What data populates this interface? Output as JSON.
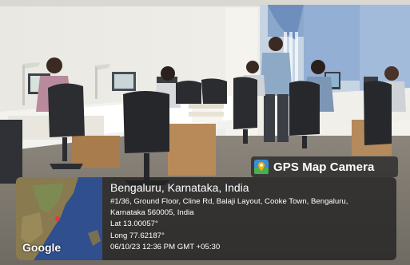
{
  "badge": {
    "label": "GPS Map Camera",
    "icon": "gps-map-camera-icon"
  },
  "map": {
    "attribution": "Google"
  },
  "location": {
    "city": "Bengaluru, Karnataka, India",
    "address_line1": "#1/36, Ground Floor, Cline Rd, Balaji Layout, Cooke Town, Bengaluru,",
    "address_line2": "Karnataka 560005, India",
    "latitude": "Lat 13.00057°",
    "longitude": "Long 77.62187°",
    "datetime": "06/10/23 12:36 PM GMT +05:30"
  },
  "colors": {
    "overlay": "#232323",
    "text": "#ffffff",
    "ocean": "#2f4f8f",
    "land": "#8a7a4f"
  }
}
